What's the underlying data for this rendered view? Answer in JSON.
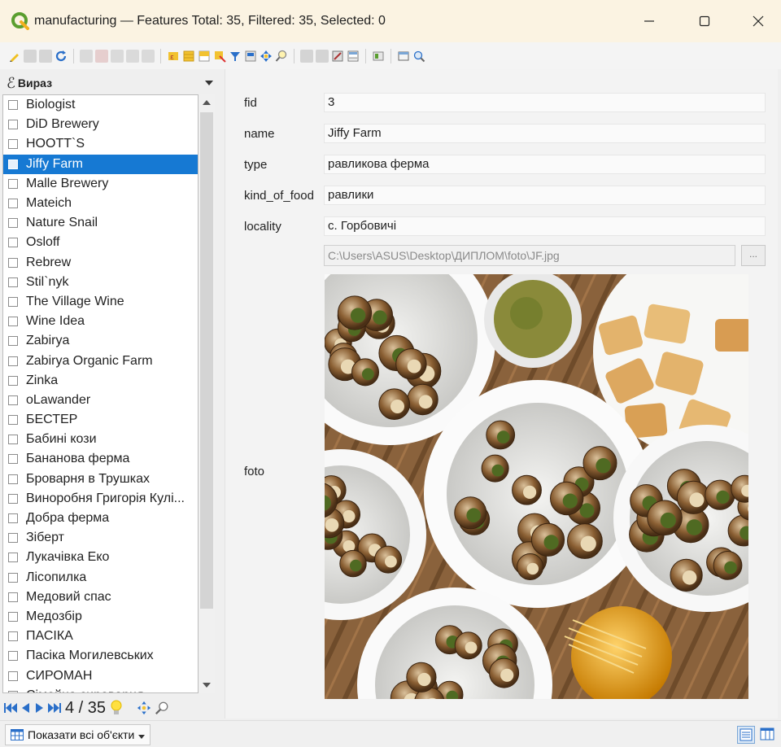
{
  "window": {
    "title": "manufacturing — Features Total: 35, Filtered: 35, Selected: 0",
    "buttons": [
      "minimize",
      "maximize",
      "close"
    ]
  },
  "toolbar": {
    "icons": [
      "pencil-icon",
      "reload-icon",
      "save-icon",
      "refresh-icon",
      "add-feature-icon",
      "delete-feature-icon",
      "cut-icon",
      "copy-icon",
      "paste-icon",
      "select-by-expression-icon",
      "select-all-icon",
      "invert-selection-icon",
      "deselect-icon",
      "filter-icon",
      "move-selection-top-icon",
      "pan-to-selected-icon",
      "zoom-to-selected-icon",
      "new-field-icon",
      "delete-field-icon",
      "field-calculator-icon",
      "conditional-formatting-icon",
      "actions-icon",
      "dock-icon",
      "zoom-map-icon"
    ]
  },
  "sidebar": {
    "expression_label": "Вираз",
    "items": [
      {
        "label": "Biologist",
        "selected": false
      },
      {
        "label": "DiD Brewery",
        "selected": false
      },
      {
        "label": "HOOTT`S",
        "selected": false
      },
      {
        "label": "Jiffy Farm",
        "selected": true
      },
      {
        "label": "Malle Brewery",
        "selected": false
      },
      {
        "label": "Mateich",
        "selected": false
      },
      {
        "label": "Nature Snail",
        "selected": false
      },
      {
        "label": "Osloff",
        "selected": false
      },
      {
        "label": "Rebrew",
        "selected": false
      },
      {
        "label": "Stil`nyk",
        "selected": false
      },
      {
        "label": "The Village Wine",
        "selected": false
      },
      {
        "label": "Wine Idea",
        "selected": false
      },
      {
        "label": "Zabirya",
        "selected": false
      },
      {
        "label": "Zabirya Organic Farm",
        "selected": false
      },
      {
        "label": "Zinka",
        "selected": false
      },
      {
        "label": "oLawander",
        "selected": false
      },
      {
        "label": "БЕСТЕР",
        "selected": false
      },
      {
        "label": "Бабині кози",
        "selected": false
      },
      {
        "label": "Бананова ферма",
        "selected": false
      },
      {
        "label": "Броварня в Трушках",
        "selected": false
      },
      {
        "label": "Виноробня Григорія Кулі...",
        "selected": false
      },
      {
        "label": "Добра ферма",
        "selected": false
      },
      {
        "label": "Зіберт",
        "selected": false
      },
      {
        "label": "Лукачівка Еко",
        "selected": false
      },
      {
        "label": "Лісопилка",
        "selected": false
      },
      {
        "label": "Медовий спас",
        "selected": false
      },
      {
        "label": "Медозбір",
        "selected": false
      },
      {
        "label": "ПАСІКА",
        "selected": false
      },
      {
        "label": "Пасіка Могилевських",
        "selected": false
      },
      {
        "label": "СИРОМАН",
        "selected": false
      },
      {
        "label": "Сімейна сироварня",
        "selected": false
      }
    ],
    "navigation": {
      "current": "4",
      "separator": "/",
      "total": "35",
      "counter_text": "4 / 35"
    }
  },
  "form": {
    "fields": [
      {
        "label": "fid",
        "value": "3"
      },
      {
        "label": "name",
        "value": "Jiffy Farm"
      },
      {
        "label": "type",
        "value": "равликова ферма"
      },
      {
        "label": "kind_of_food",
        "value": "равлики"
      },
      {
        "label": "locality",
        "value": "с. Горбовичі"
      }
    ],
    "foto_label": "foto",
    "foto_path": "C:\\Users\\ASUS\\Desktop\\ДИПЛОМ\\foto\\JF.jpg",
    "browse_label": "..."
  },
  "bottombar": {
    "show_all_label": "Показати всі об'єкти"
  },
  "colors": {
    "selection": "#1679d3",
    "titlebar": "#fbf3e2",
    "qgis_green": "#5a9e2f"
  }
}
